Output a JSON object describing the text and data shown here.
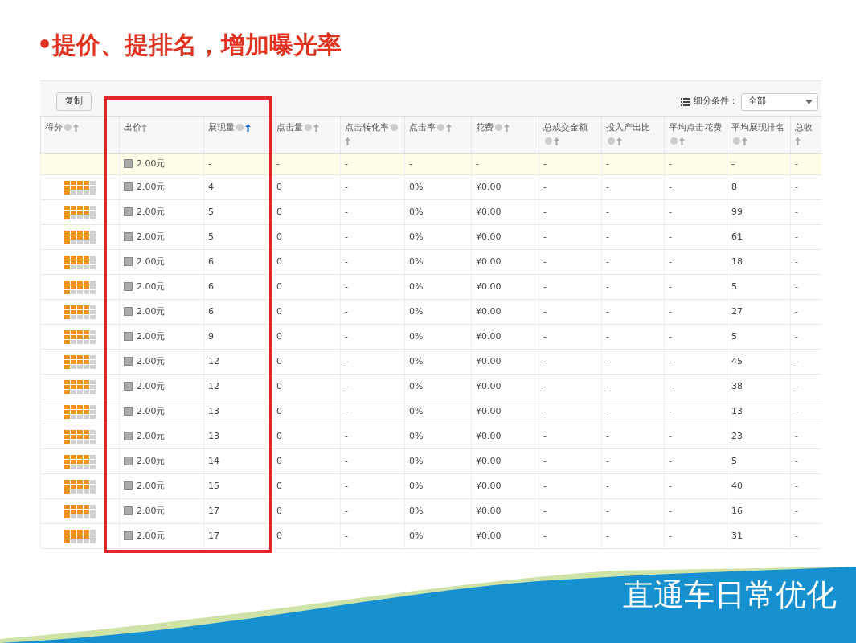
{
  "title": "•提价、提排名，增加曝光率",
  "toolbar": {
    "copy_button": "复制",
    "filter_label": "细分条件：",
    "filter_value": "全部"
  },
  "table": {
    "columns": [
      {
        "label": "得分",
        "help": true,
        "sort_active": false
      },
      {
        "label": "出价",
        "help": false,
        "sort_active": false
      },
      {
        "label": "展现量",
        "help": true,
        "sort_active": true
      },
      {
        "label": "点击量",
        "help": true,
        "sort_active": false
      },
      {
        "label": "点击转化率",
        "help": true,
        "sort_active": false
      },
      {
        "label": "点击率",
        "help": true,
        "sort_active": false
      },
      {
        "label": "花费",
        "help": true,
        "sort_active": false
      },
      {
        "label": "总成交金额",
        "help": true,
        "sort_active": false
      },
      {
        "label": "投入产出比",
        "help": true,
        "sort_active": false
      },
      {
        "label": "平均点击花费",
        "help": true,
        "sort_active": false
      },
      {
        "label": "平均展现排名",
        "help": true,
        "sort_active": false
      },
      {
        "label": "总收",
        "help": false,
        "sort_active": false
      }
    ],
    "rows": [
      {
        "kind": "summary",
        "cells": [
          "",
          "2.00元",
          "-",
          "-",
          "-",
          "-",
          "-",
          "-",
          "-",
          "-",
          "-",
          "-"
        ]
      },
      {
        "kind": "keyword",
        "cells": [
          "",
          "2.00元",
          "4",
          "0",
          "-",
          "0%",
          "¥0.00",
          "-",
          "-",
          "-",
          "8",
          "-"
        ]
      },
      {
        "kind": "keyword",
        "cells": [
          "",
          "2.00元",
          "5",
          "0",
          "-",
          "0%",
          "¥0.00",
          "-",
          "-",
          "-",
          "99",
          "-"
        ]
      },
      {
        "kind": "keyword",
        "cells": [
          "",
          "2.00元",
          "5",
          "0",
          "-",
          "0%",
          "¥0.00",
          "-",
          "-",
          "-",
          "61",
          "-"
        ]
      },
      {
        "kind": "keyword",
        "cells": [
          "",
          "2.00元",
          "6",
          "0",
          "-",
          "0%",
          "¥0.00",
          "-",
          "-",
          "-",
          "18",
          "-"
        ]
      },
      {
        "kind": "keyword",
        "cells": [
          "",
          "2.00元",
          "6",
          "0",
          "-",
          "0%",
          "¥0.00",
          "-",
          "-",
          "-",
          "5",
          "-"
        ]
      },
      {
        "kind": "keyword",
        "cells": [
          "",
          "2.00元",
          "6",
          "0",
          "-",
          "0%",
          "¥0.00",
          "-",
          "-",
          "-",
          "27",
          "-"
        ]
      },
      {
        "kind": "keyword",
        "cells": [
          "",
          "2.00元",
          "9",
          "0",
          "-",
          "0%",
          "¥0.00",
          "-",
          "-",
          "-",
          "5",
          "-"
        ]
      },
      {
        "kind": "keyword",
        "cells": [
          "",
          "2.00元",
          "12",
          "0",
          "-",
          "0%",
          "¥0.00",
          "-",
          "-",
          "-",
          "45",
          "-"
        ]
      },
      {
        "kind": "keyword",
        "cells": [
          "",
          "2.00元",
          "12",
          "0",
          "-",
          "0%",
          "¥0.00",
          "-",
          "-",
          "-",
          "38",
          "-"
        ]
      },
      {
        "kind": "keyword",
        "cells": [
          "",
          "2.00元",
          "13",
          "0",
          "-",
          "0%",
          "¥0.00",
          "-",
          "-",
          "-",
          "13",
          "-"
        ]
      },
      {
        "kind": "keyword",
        "cells": [
          "",
          "2.00元",
          "13",
          "0",
          "-",
          "0%",
          "¥0.00",
          "-",
          "-",
          "-",
          "23",
          "-"
        ]
      },
      {
        "kind": "keyword",
        "cells": [
          "",
          "2.00元",
          "14",
          "0",
          "-",
          "0%",
          "¥0.00",
          "-",
          "-",
          "-",
          "5",
          "-"
        ]
      },
      {
        "kind": "keyword",
        "cells": [
          "",
          "2.00元",
          "15",
          "0",
          "-",
          "0%",
          "¥0.00",
          "-",
          "-",
          "-",
          "40",
          "-"
        ]
      },
      {
        "kind": "keyword",
        "cells": [
          "",
          "2.00元",
          "17",
          "0",
          "-",
          "0%",
          "¥0.00",
          "-",
          "-",
          "-",
          "16",
          "-"
        ]
      },
      {
        "kind": "keyword",
        "cells": [
          "",
          "2.00元",
          "17",
          "0",
          "-",
          "0%",
          "¥0.00",
          "-",
          "-",
          "-",
          "31",
          "-"
        ]
      }
    ]
  },
  "annotation": {
    "kind": "frame"
  },
  "footer_title": "直通车日常优化"
}
